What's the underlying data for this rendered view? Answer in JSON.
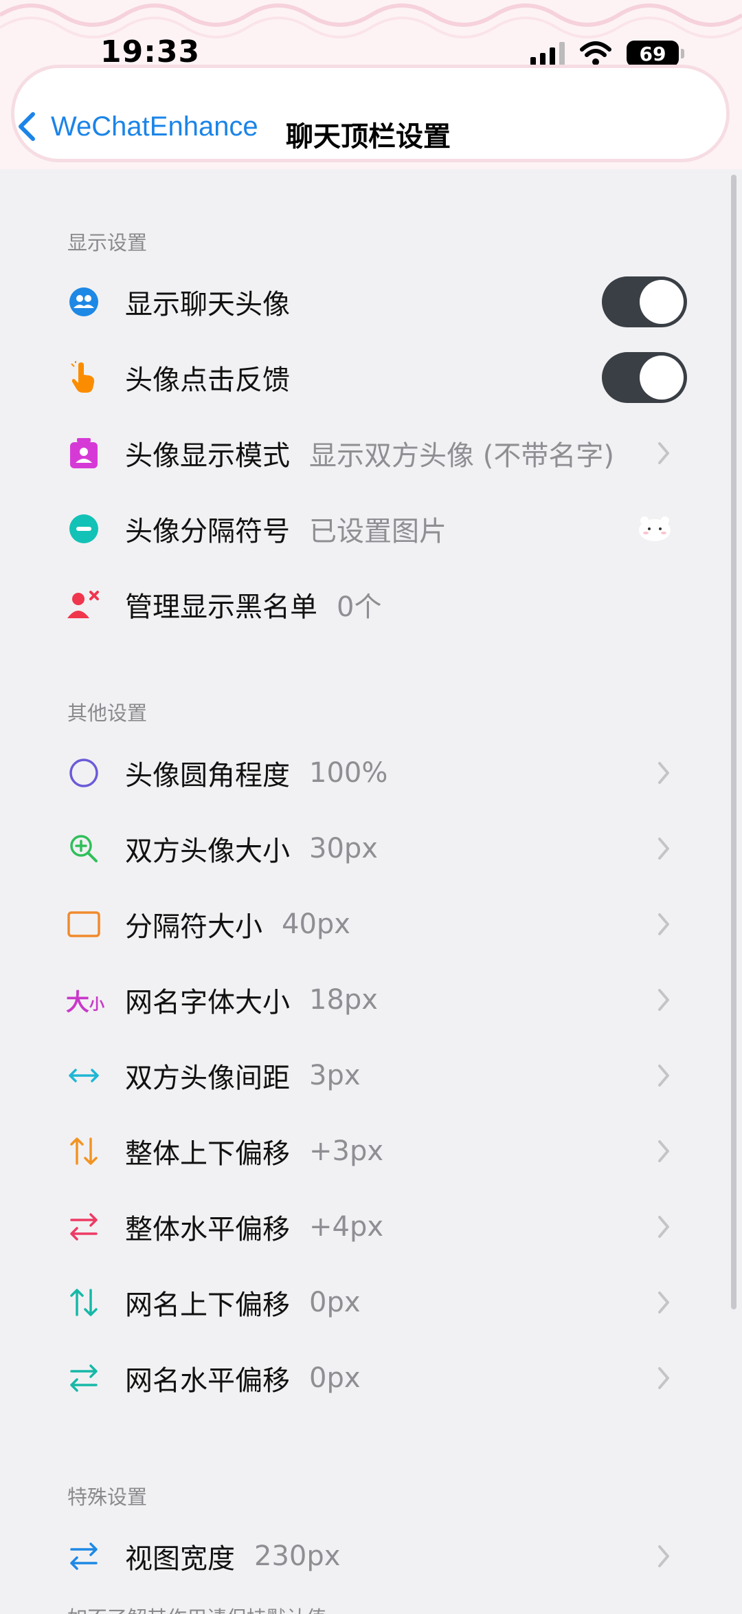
{
  "status_bar": {
    "time": "19:33",
    "battery": "69"
  },
  "nav": {
    "back_label": "WeChatEnhance",
    "title": "聊天顶栏设置"
  },
  "sections": [
    {
      "title": "显示设置",
      "rows": [
        {
          "label": "显示聊天头像",
          "type": "toggle",
          "on": true,
          "icon": "people-icon",
          "color": "#1e88e5"
        },
        {
          "label": "头像点击反馈",
          "type": "toggle",
          "on": true,
          "icon": "tap-hand-icon",
          "color": "#fb8c00"
        },
        {
          "label": "头像显示模式",
          "value": "显示双方头像 (不带名字)",
          "type": "chevron",
          "icon": "contact-card-icon",
          "color": "#d63ad6"
        },
        {
          "label": "头像分隔符号",
          "value": "已设置图片",
          "type": "image",
          "icon": "minus-circle-icon",
          "color": "#12c2b6"
        },
        {
          "label": "管理显示黑名单",
          "value": "0个",
          "type": "none",
          "icon": "block-user-icon",
          "color": "#f0364d"
        }
      ]
    },
    {
      "title": "其他设置",
      "rows": [
        {
          "label": "头像圆角程度",
          "value": "100%",
          "icon": "circle-icon",
          "color": "#6a5bd8"
        },
        {
          "label": "双方头像大小",
          "value": "30px",
          "icon": "zoom-in-icon",
          "color": "#2fbf59"
        },
        {
          "label": "分隔符大小",
          "value": "40px",
          "icon": "rectangle-icon",
          "color": "#f08a2c"
        },
        {
          "label": "网名字体大小",
          "value": "18px",
          "icon": "font-size-icon",
          "color": "#c938c9",
          "icon_text_big": "大",
          "icon_text_small": "小"
        },
        {
          "label": "双方头像间距",
          "value": "3px",
          "icon": "horizontal-arrows-icon",
          "color": "#1fb6d4"
        },
        {
          "label": "整体上下偏移",
          "value": "+3px",
          "icon": "vertical-swap-icon",
          "color": "#f29422"
        },
        {
          "label": "整体水平偏移",
          "value": "+4px",
          "icon": "horizontal-swap-icon",
          "color": "#ee3a64"
        },
        {
          "label": "网名上下偏移",
          "value": "0px",
          "icon": "vertical-swap-icon",
          "color": "#17b8a8"
        },
        {
          "label": "网名水平偏移",
          "value": "0px",
          "icon": "horizontal-swap-icon",
          "color": "#17b8a8"
        }
      ]
    },
    {
      "title": "特殊设置",
      "rows": [
        {
          "label": "视图宽度",
          "value": "230px",
          "icon": "horizontal-swap-icon",
          "color": "#1e88e5"
        }
      ]
    }
  ],
  "footnote": "如不了解其作用请保持默认值"
}
